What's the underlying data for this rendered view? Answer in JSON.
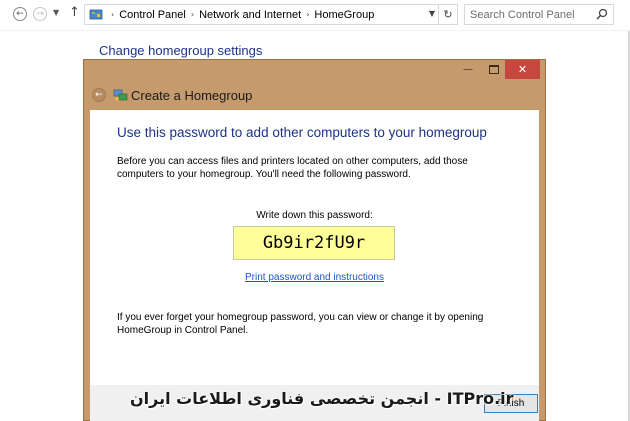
{
  "toolbar": {
    "breadcrumbs": [
      "Control Panel",
      "Network and Internet",
      "HomeGroup"
    ],
    "search_placeholder": "Search Control Panel"
  },
  "background_page": {
    "title": "Change homegroup settings"
  },
  "dialog": {
    "title": "Create a Homegroup",
    "heading": "Use this password to add other computers to your homegroup",
    "description": "Before you can access files and printers located on other computers, add those computers to your homegroup. You'll need the following password.",
    "password_label": "Write down this password:",
    "password": "Gb9ir2fU9r",
    "print_link": "Print password and instructions",
    "forget_note": "If you ever forget your homegroup password, you can view or change it by opening HomeGroup in Control Panel.",
    "finish_label": "Finish",
    "accent_color": "#c59a6c"
  },
  "watermark": "انجمن تخصصی فناوری اطلاعات ایران - ITPro.ir",
  "icons": [
    "back-arrow-icon",
    "forward-arrow-icon",
    "up-arrow-icon",
    "control-panel-icon",
    "refresh-icon",
    "search-icon",
    "close-icon",
    "minimize-icon",
    "maximize-icon",
    "homegroup-icon"
  ]
}
